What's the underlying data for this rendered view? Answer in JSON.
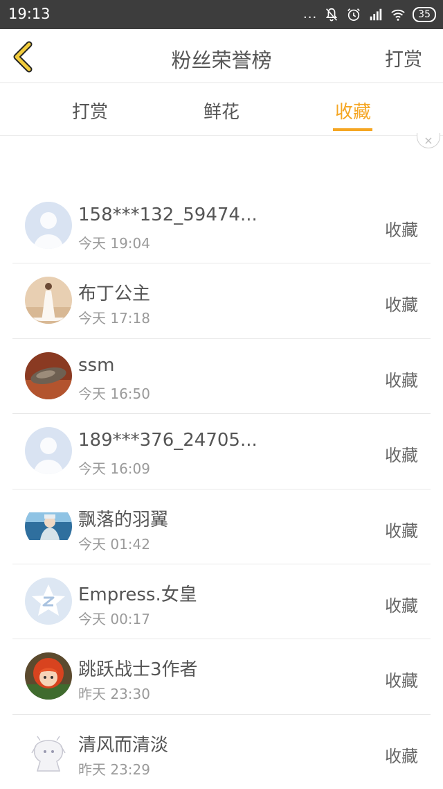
{
  "status": {
    "time": "19:13",
    "dots": "...",
    "battery": "35"
  },
  "header": {
    "title": "粉丝荣誉榜",
    "action": "打赏"
  },
  "tabs": [
    {
      "label": "打赏",
      "active": false
    },
    {
      "label": "鲜花",
      "active": false
    },
    {
      "label": "收藏",
      "active": true
    }
  ],
  "colors": {
    "accent": "#f5a623",
    "status_bar": "#3d3d3d"
  },
  "close_label": "×",
  "fans": [
    {
      "name": "158***132_59474...",
      "time": "今天 19:04",
      "action": "收藏",
      "avatar": "default-avatar"
    },
    {
      "name": "布丁公主",
      "time": "今天 17:18",
      "action": "收藏",
      "avatar": "bride-photo"
    },
    {
      "name": "ssm",
      "time": "今天 16:50",
      "action": "收藏",
      "avatar": "rock-photo"
    },
    {
      "name": "189***376_24705...",
      "time": "今天 16:09",
      "action": "收藏",
      "avatar": "default-avatar"
    },
    {
      "name": "飘落的羽翼",
      "time": "今天 01:42",
      "action": "收藏",
      "avatar": "anime-photo"
    },
    {
      "name": "Empress.女皇",
      "time": "今天 00:17",
      "action": "收藏",
      "avatar": "qq-logo"
    },
    {
      "name": "跳跃战士3作者",
      "time": "昨天 23:30",
      "action": "收藏",
      "avatar": "cartoon-girl"
    },
    {
      "name": "清风而清淡",
      "time": "昨天 23:29",
      "action": "收藏",
      "avatar": "sketch-character"
    }
  ]
}
